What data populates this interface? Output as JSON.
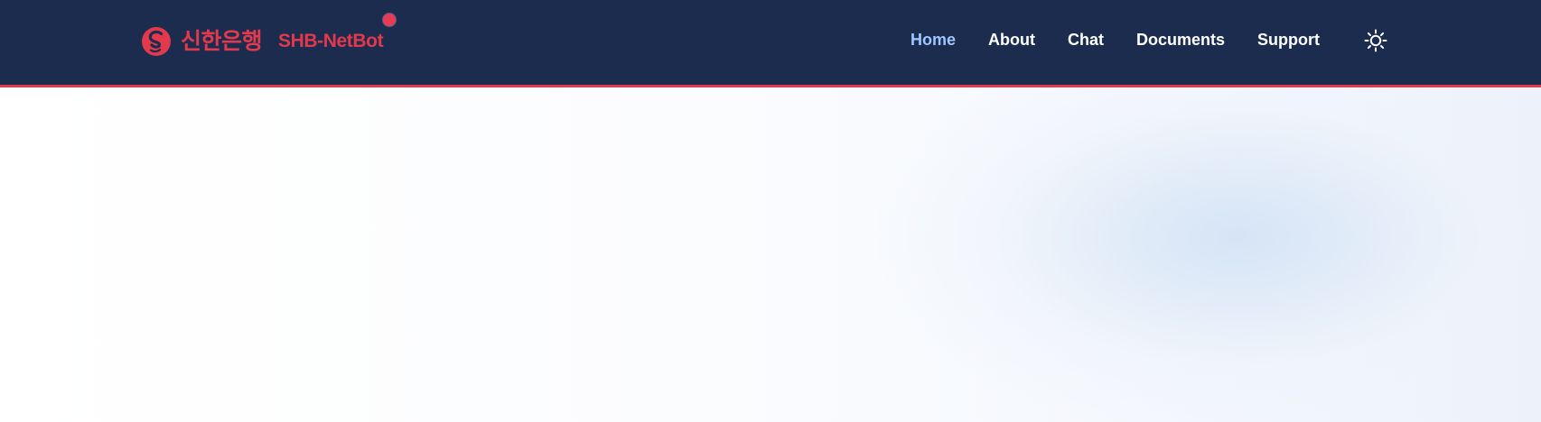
{
  "header": {
    "bank_name": "신한은행",
    "app_name": "SHB-NetBot",
    "colors": {
      "background": "#1b2c4f",
      "brand": "#e2394d",
      "active_link": "#9fc7ff",
      "text": "#ffffff"
    },
    "icons": {
      "logo": "shinhan-logo-icon",
      "theme_toggle": "sun-icon"
    }
  },
  "nav": {
    "items": [
      {
        "label": "Home",
        "active": true
      },
      {
        "label": "About",
        "active": false
      },
      {
        "label": "Chat",
        "active": false
      },
      {
        "label": "Documents",
        "active": false
      },
      {
        "label": "Support",
        "active": false
      }
    ]
  }
}
